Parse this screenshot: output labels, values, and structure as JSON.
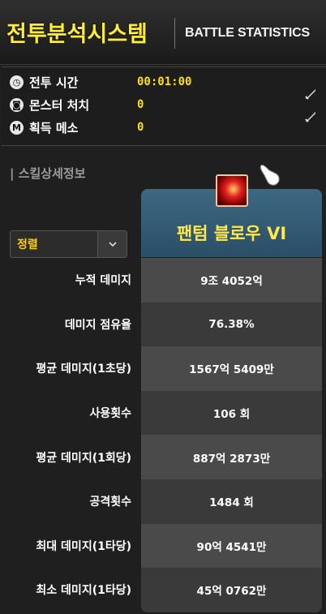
{
  "header": {
    "title_kr": "전투분석시스템",
    "title_en": "BATTLE STATISTICS"
  },
  "stats": [
    {
      "icon": "clock-icon",
      "glyph": "◷",
      "label": "전투 시간",
      "value": "00:01:00"
    },
    {
      "icon": "monster-icon",
      "glyph": "◙",
      "label": "몬스터 처치",
      "value": "0"
    },
    {
      "icon": "meso-icon",
      "glyph": "M",
      "label": "획득 메소",
      "value": "0"
    }
  ],
  "section": {
    "title": "| 스킬상세정보"
  },
  "skill": {
    "name": "팬텀 블로우 VI",
    "icon": "phantom-blow-skill-icon"
  },
  "sort": {
    "label": "정렬",
    "arrow": "⌄"
  },
  "rows": [
    {
      "label": "누적 데미지",
      "value": "9조 4052억"
    },
    {
      "label": "데미지 점유율",
      "value": "76.38%"
    },
    {
      "label": "평균 데미지(1초당)",
      "value": "1567억 5409만"
    },
    {
      "label": "사용횟수",
      "value": "106 회"
    },
    {
      "label": "평균 데미지(1회당)",
      "value": "887억 2873만"
    },
    {
      "label": "공격횟수",
      "value": "1484 회"
    },
    {
      "label": "최대 데미지(1타당)",
      "value": "90억 4541만"
    },
    {
      "label": "최소 데미지(1타당)",
      "value": "45억 0762만"
    }
  ],
  "colors": {
    "title": "#ffee33",
    "stat_value": "#ffe000",
    "skill_name": "#ffe94a",
    "skill_header": "#3d6882"
  }
}
